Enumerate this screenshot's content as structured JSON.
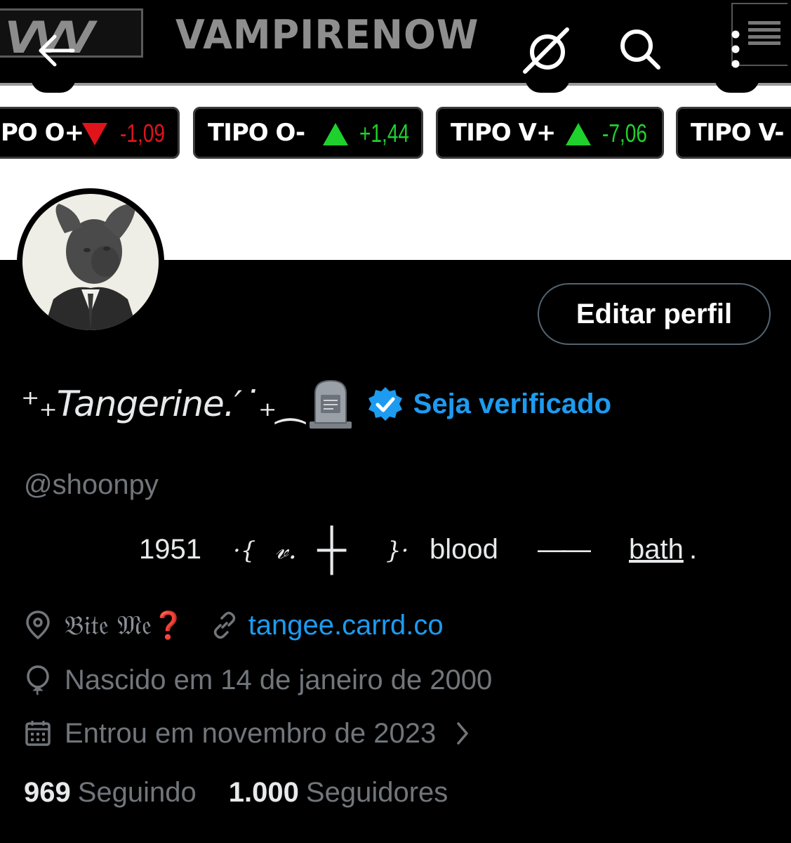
{
  "header": {
    "brand": "VAMPIRENOW",
    "logo_text": "VVV",
    "icons": [
      "back-arrow-icon",
      "slashed-circle-icon",
      "search-icon",
      "more-vertical-icon",
      "menu-lines-icon"
    ]
  },
  "ticker": [
    {
      "label": "PO O+",
      "direction": "down",
      "delta": "-1,09",
      "color": "#e0141b"
    },
    {
      "label": "TIPO O-",
      "direction": "up",
      "delta": "+1,44",
      "color": "#1fd12c"
    },
    {
      "label": "TIPO V+",
      "direction": "up",
      "delta": "-7,06",
      "color": "#1fd12c"
    },
    {
      "label": "TIPO V-",
      "direction": "",
      "delta": "",
      "color": ""
    }
  ],
  "profile": {
    "edit_label": "Editar perfil",
    "display_name": "⁺₊Tangerine.′˙₊⁔",
    "verify_label": "Seja verificado",
    "handle": "@shoonpy",
    "bio": {
      "year": "1951",
      "brace_open": "·{",
      "v": "𝓋.",
      "cross": "┼",
      "brace_close": "}·",
      "word1": "blood",
      "dash": "——",
      "word2": "bath",
      "dot": "."
    },
    "location": "𝔅𝔦𝔱𝔢 𝔐𝔢❓",
    "website": "tangee.carrd.co",
    "birthday": "Nascido em 14 de janeiro de 2000",
    "joined": "Entrou em novembro de 2023",
    "following_count": "969",
    "following_label": "Seguindo",
    "followers_count": "1.000",
    "followers_label": "Seguidores"
  },
  "colors": {
    "accent": "#1d9bf0",
    "muted": "#71767b",
    "ticker_down": "#e0141b",
    "ticker_up": "#1fd12c"
  }
}
